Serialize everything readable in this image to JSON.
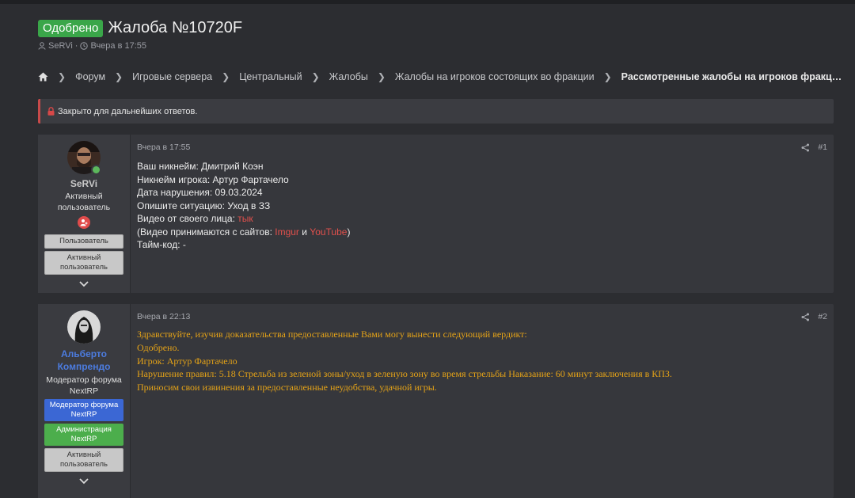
{
  "header": {
    "badge": "Одобрено",
    "title": "Жалоба №10720F",
    "author": "SeRVi",
    "meta_sep": "·",
    "time": "Вчера в 17:55"
  },
  "breadcrumb": {
    "items": [
      "Форум",
      "Игровые сервера",
      "Центральный",
      "Жалобы",
      "Жалобы на игроков состоящих во фракции"
    ],
    "current": "Рассмотренные жалобы на игроков фракц…"
  },
  "notice": {
    "text": "Закрыто для дальнейших ответов."
  },
  "posts": [
    {
      "user": {
        "name": "SeRVi",
        "title_lines": [
          "Активный",
          "пользователь"
        ],
        "banners": [
          "Пользователь",
          "Активный пользователь"
        ]
      },
      "date": "Вчера в 17:55",
      "number": "#1",
      "lines": {
        "l1": "Ваш никнейм: Дмитрий Коэн",
        "l2": "Никнейм игрока: Артур Фартачело",
        "l3": "Дата нарушения: 09.03.2024",
        "l4": "Опишите ситуацию: Уход в ЗЗ",
        "l5_prefix": "Видео от своего лица: ",
        "l5_link": "тык",
        "l6_prefix": "(Видео принимаются с сайтов: ",
        "l6_link1": "Imgur",
        "l6_mid": " и ",
        "l6_link2": "YouTube",
        "l6_suffix": ")",
        "l7": "Тайм-код: -"
      }
    },
    {
      "user": {
        "name": "Альберто Компрендо",
        "title_lines": [
          "Модератор форума",
          "NextRP"
        ],
        "banners": [
          "Модератор форума NextRP",
          "Администрация NextRP",
          "Активный пользователь"
        ]
      },
      "date": "Вчера в 22:13",
      "number": "#2",
      "lines": [
        "Здравствуйте, изучив доказательства предоставленные Вами могу вынести следующий вердикт:",
        "Одобрено.",
        "Игрок: Артур Фартачело",
        "Нарушение правил: 5.18 Стрельба из зеленой зоны/уход в зеленую зону во время стрельбы Наказание: 60 минут заключения в КПЗ.",
        "Приносим свои извинения за предоставленные неудобства, удачной игры."
      ]
    }
  ],
  "colors": {
    "approved": "#3aa649",
    "reply_text": "#e5a317",
    "link": "#e2504c",
    "moderator_name": "#4c7ce0"
  }
}
